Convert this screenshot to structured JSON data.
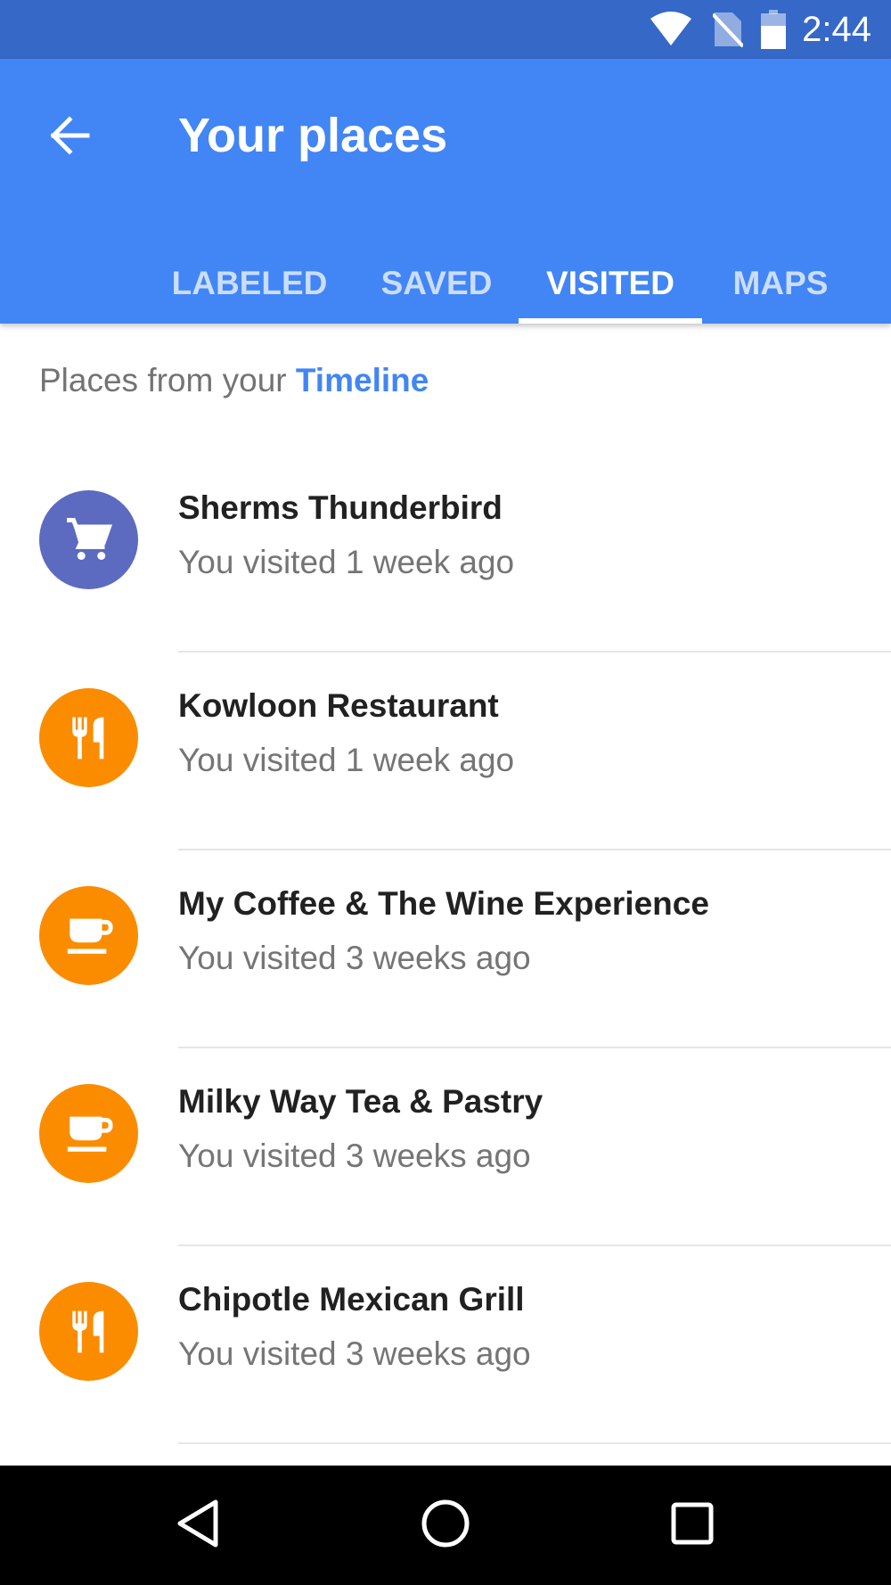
{
  "status_bar": {
    "time": "2:44",
    "icons": [
      "wifi-icon",
      "no-sim-icon",
      "battery-icon"
    ]
  },
  "app_bar": {
    "title": "Your places",
    "back_icon": "arrow-back-icon",
    "background_color": "#4285f4"
  },
  "tabs": [
    {
      "label": "LABELED",
      "active": false
    },
    {
      "label": "SAVED",
      "active": false
    },
    {
      "label": "VISITED",
      "active": true
    },
    {
      "label": "MAPS",
      "active": false
    }
  ],
  "subheader": {
    "prefix": "Places from your",
    "link": "Timeline"
  },
  "places": [
    {
      "name": "Sherms Thunderbird",
      "visited": "You visited 1 week ago",
      "icon": "shopping-cart-icon",
      "color": "#5c6bc0"
    },
    {
      "name": "Kowloon Restaurant",
      "visited": "You visited 1 week ago",
      "icon": "restaurant-icon",
      "color": "#fb8c00"
    },
    {
      "name": "My Coffee & The Wine Experience",
      "visited": "You visited 3 weeks ago",
      "icon": "coffee-cup-icon",
      "color": "#fb8c00"
    },
    {
      "name": "Milky Way Tea & Pastry",
      "visited": "You visited 3 weeks ago",
      "icon": "coffee-cup-icon",
      "color": "#fb8c00"
    },
    {
      "name": "Chipotle Mexican Grill",
      "visited": "You visited 3 weeks ago",
      "icon": "restaurant-icon",
      "color": "#fb8c00"
    }
  ],
  "nav_bar": {
    "buttons": [
      "back-triangle-icon",
      "home-circle-icon",
      "recents-square-icon"
    ]
  }
}
